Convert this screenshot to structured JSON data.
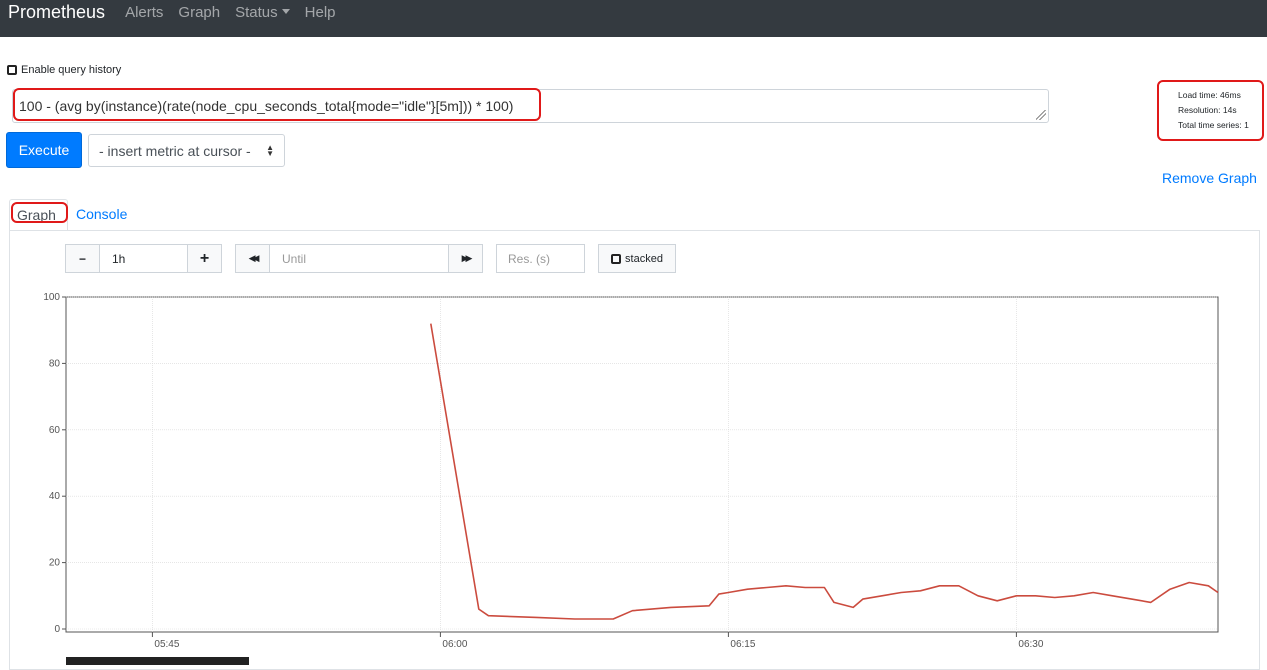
{
  "navbar": {
    "brand": "Prometheus",
    "items": [
      "Alerts",
      "Graph",
      "Status",
      "Help"
    ]
  },
  "query_history": {
    "label": "Enable query history",
    "checked": false
  },
  "expression": {
    "value": "100 - (avg by(instance)(rate(node_cpu_seconds_total{mode=\"idle\"}[5m])) * 100)"
  },
  "execute_label": "Execute",
  "insert_metric_label": "- insert metric at cursor -",
  "stats": {
    "load_time": "Load time: 46ms",
    "resolution": "Resolution: 14s",
    "total_series": "Total time series: 1"
  },
  "remove_graph_label": "Remove Graph",
  "tabs": {
    "graph": "Graph",
    "console": "Console",
    "active": "Graph"
  },
  "graph_controls": {
    "minus": "−",
    "range": "1h",
    "plus": "+",
    "back": "◀◀",
    "until_placeholder": "Until",
    "forward": "▶▶",
    "res_placeholder": "Res. (s)",
    "stacked_label": "stacked"
  },
  "colors": {
    "series": "#cb4b3e",
    "accent": "#007bff",
    "navbar": "#343a40",
    "highlight": "#e01919"
  },
  "chart_data": {
    "type": "line",
    "ylim": [
      0,
      100
    ],
    "yticks": [
      0,
      20,
      40,
      60,
      80,
      100
    ],
    "xticks": [
      "05:45",
      "06:00",
      "06:15",
      "06:30"
    ],
    "grid": true,
    "series": [
      {
        "x": [
          "05:59:30",
          "06:02:00",
          "06:02:30",
          "06:05:00",
          "06:07:00",
          "06:09:00",
          "06:10:00",
          "06:12:00",
          "06:14:00",
          "06:14:30",
          "06:15:00",
          "06:16:00",
          "06:17:00",
          "06:18:00",
          "06:19:00",
          "06:20:00",
          "06:20:30",
          "06:21:30",
          "06:22:00",
          "06:23:00",
          "06:24:00",
          "06:25:00",
          "06:26:00",
          "06:27:00",
          "06:28:00",
          "06:29:00",
          "06:30:00",
          "06:31:00",
          "06:32:00",
          "06:33:00",
          "06:34:00",
          "06:35:00",
          "06:36:00",
          "06:37:00",
          "06:38:00",
          "06:39:00",
          "06:40:00",
          "06:40:30"
        ],
        "y": [
          92,
          6,
          4,
          3.5,
          3,
          3,
          5.5,
          6.5,
          7,
          10.5,
          11,
          12,
          12.5,
          13,
          12.5,
          12.5,
          8,
          6.5,
          9,
          10,
          11,
          11.5,
          13,
          13,
          10,
          8.5,
          10,
          10,
          9.5,
          10,
          11,
          10,
          9,
          8,
          12,
          14,
          13,
          11
        ]
      }
    ]
  }
}
